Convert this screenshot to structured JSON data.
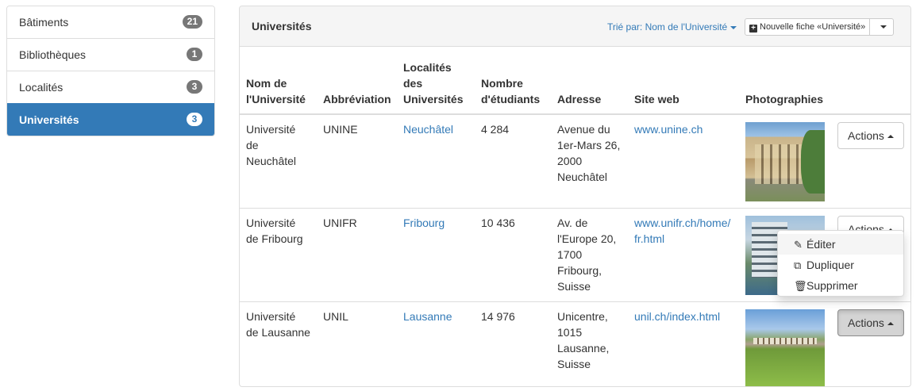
{
  "sidebar": {
    "items": [
      {
        "label": "Bâtiments",
        "count": "21"
      },
      {
        "label": "Bibliothèques",
        "count": "1"
      },
      {
        "label": "Localités",
        "count": "3"
      },
      {
        "label": "Universités",
        "count": "3",
        "active": true
      }
    ]
  },
  "panel": {
    "title": "Universités",
    "sort_label": "Trié par: Nom de l'Université",
    "new_button_label": "Nouvelle fiche «Université»"
  },
  "table": {
    "headers": [
      "Nom de l'Université",
      "Abbréviation",
      "Localités des Universités",
      "Nombre d'étudiants",
      "Adresse",
      "Site web",
      "Photographies",
      ""
    ],
    "rows": [
      {
        "name": "Université de Neuchâtel",
        "abbr": "UNINE",
        "locality": "Neuchâtel",
        "students": "4 284",
        "address": "Avenue du 1er-Mars 26, 2000 Neuchâtel",
        "website": "www.unine.ch",
        "photo": "photo-neuchatel"
      },
      {
        "name": "Université de Fribourg",
        "abbr": "UNIFR",
        "locality": "Fribourg",
        "students": "10 436",
        "address": "Av. de l'Europe 20, 1700 Fribourg, Suisse",
        "website": "www.unifr.ch/home/fr.html",
        "photo": "photo-fribourg"
      },
      {
        "name": "Université de Lausanne",
        "abbr": "UNIL",
        "locality": "Lausanne",
        "students": "14 976",
        "address": "Unicentre, 1015 Lausanne, Suisse",
        "website": "unil.ch/index.html",
        "photo": "photo-lausanne"
      }
    ],
    "actions_label": "Actions"
  },
  "dropdown": {
    "items": [
      {
        "label": "Éditer",
        "icon": "pencil-icon"
      },
      {
        "label": "Dupliquer",
        "icon": "copy-icon"
      },
      {
        "label": "Supprimer",
        "icon": "trash-icon"
      }
    ]
  },
  "colors": {
    "primary": "#337ab7",
    "badge": "#777777",
    "border": "#dddddd",
    "heading_bg": "#f5f5f5"
  }
}
